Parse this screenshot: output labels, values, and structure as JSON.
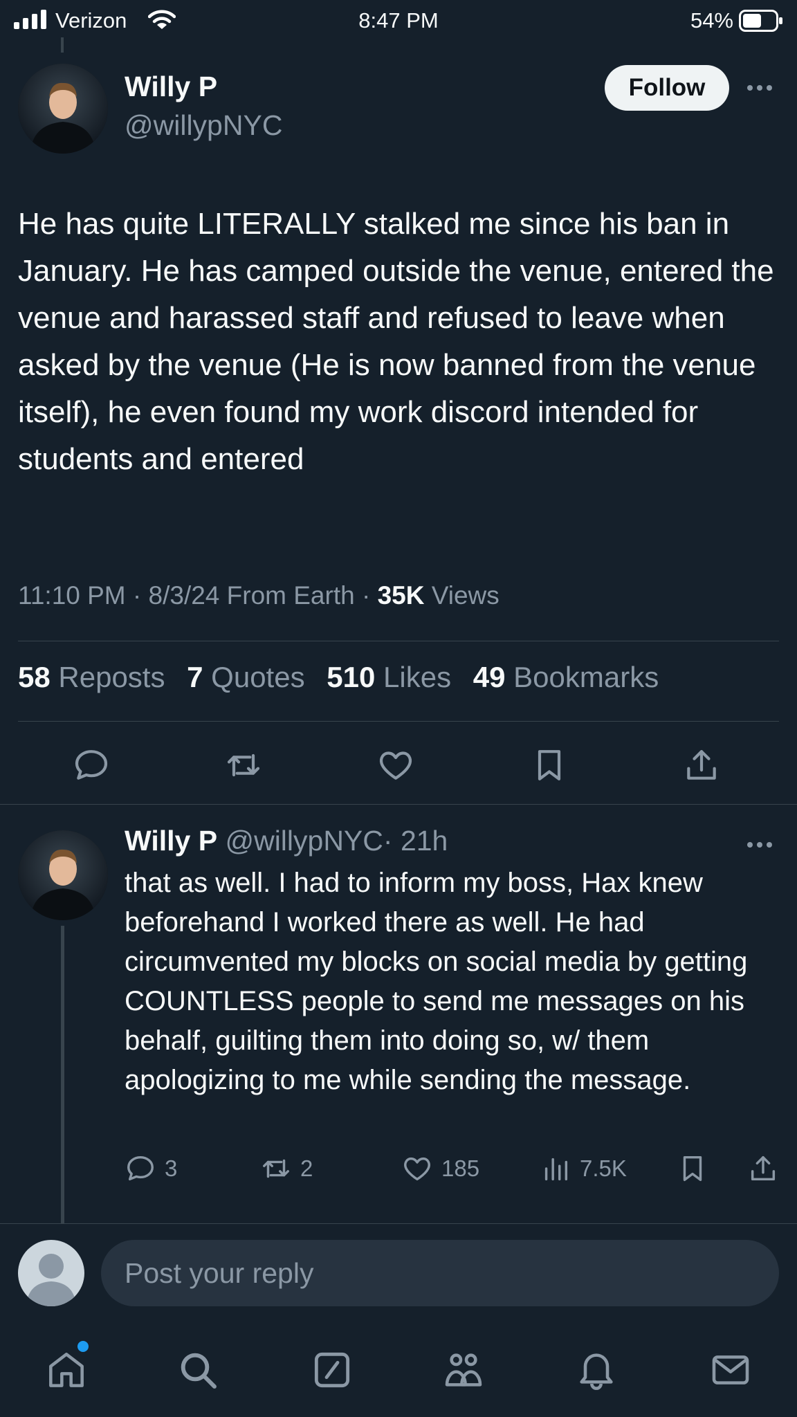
{
  "status_bar": {
    "carrier": "Verizon",
    "time": "8:47 PM",
    "battery": "54%"
  },
  "tweet": {
    "author_name": "Willy P",
    "author_handle": "@willypNYC",
    "follow_label": "Follow",
    "text": "He has quite LITERALLY stalked me since his ban in January. He has camped outside the venue, entered the venue and harassed staff and refused to leave when asked by the venue (He is now banned from the venue itself), he even found my work discord intended for students and entered",
    "timestamp": "11:10 PM · 8/3/24 From Earth · ",
    "views_count": "35K",
    "views_label": " Views",
    "stats": [
      {
        "count": "58",
        "label": "Reposts"
      },
      {
        "count": "7",
        "label": "Quotes"
      },
      {
        "count": "510",
        "label": "Likes"
      },
      {
        "count": "49",
        "label": "Bookmarks"
      }
    ]
  },
  "reply": {
    "author_name": "Willy P",
    "author_handle": "@willypNYC",
    "age": "· 21h",
    "text": "that as well. I had to inform my boss, Hax knew beforehand I worked there as well. He had circumvented my blocks on social media by getting COUNTLESS people to send me messages on his behalf, guilting them into doing so, w/ them apologizing to me while sending the message.",
    "replies": "3",
    "reposts": "2",
    "likes": "185",
    "views": "7.5K"
  },
  "composer": {
    "placeholder": "Post your reply"
  },
  "icons": {
    "reply": "comment-icon",
    "repost": "repost-icon",
    "like": "heart-icon",
    "bookmark": "bookmark-icon",
    "share": "share-icon",
    "views": "analytics-icon",
    "tabs": [
      "home-icon",
      "search-icon",
      "grok-icon",
      "communities-icon",
      "notifications-icon",
      "messages-icon"
    ]
  },
  "colors": {
    "background": "#15202b",
    "muted": "#8b98a5",
    "accent": "#1d9bf0"
  }
}
